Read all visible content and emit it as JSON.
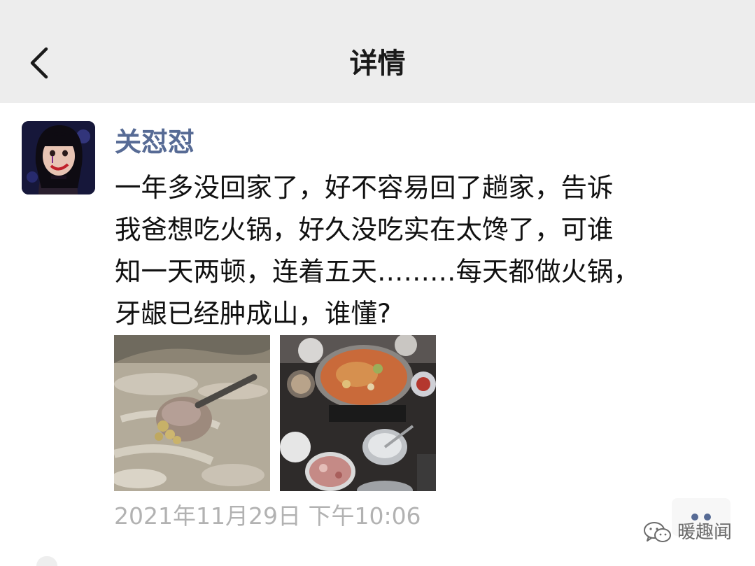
{
  "header": {
    "title": "详情",
    "back_icon": "chevron-left-icon"
  },
  "post": {
    "author": "关怼怼",
    "text": "一年多没回家了，好不容易回了趟家，告诉\n我爸想吃火锅，好久没吃实在太馋了，可谁\n知一天两顿，连着五天………每天都做火锅，\n牙龈已经肿成山，谁懂?",
    "timestamp": "2021年11月29日 下午10:06",
    "images": [
      "hotpot-closeup-photo",
      "hotpot-table-photo"
    ]
  },
  "actions": {
    "more_icon": "more-dots-icon"
  },
  "watermark": {
    "text": "暖趣闻",
    "icon": "wechat-logo-icon"
  },
  "colors": {
    "nav_background": "#ededed",
    "username": "#576b95",
    "timestamp": "#b2b2b2",
    "body_text": "#111111"
  }
}
